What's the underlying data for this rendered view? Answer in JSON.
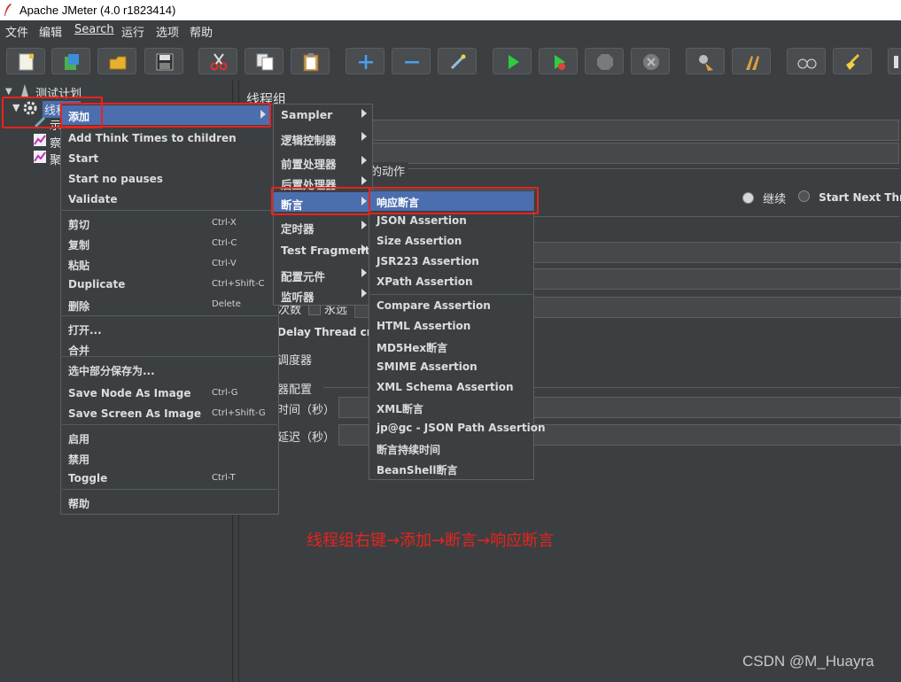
{
  "window": {
    "title": "Apache JMeter (4.0 r1823414)"
  },
  "menubar": {
    "items": [
      "文件",
      "编辑",
      "Search",
      "运行",
      "选项",
      "帮助"
    ]
  },
  "toolbar": {
    "icons": [
      "new-icon",
      "templates-icon",
      "open-icon",
      "save-icon",
      "cut-icon",
      "copy-icon",
      "paste-icon",
      "expand-icon",
      "collapse-icon",
      "toggle-icon",
      "start-icon",
      "start-no-pauses-icon",
      "stop-icon",
      "shutdown-icon",
      "clear-icon",
      "clear-all-icon",
      "search-icon",
      "reset-search-icon",
      "more-icon"
    ]
  },
  "tree": {
    "root_label": "测试计划",
    "thread_group_label": "线程组",
    "child1_label": "示",
    "child2_label": "察",
    "child3_label": "聚"
  },
  "right_panel": {
    "title": "线程组",
    "error_action_label": "的动作",
    "radio_continue": "继续",
    "radio_start_next": "Start Next Threa",
    "loop_label": "次数",
    "forever_label": "永远",
    "delay_label": "Delay Thread creat",
    "scheduler_label": "调度器",
    "scheduler_config_label": "器配置",
    "duration_label": "时间（秒）",
    "startup_delay_label": "延迟（秒）"
  },
  "context_menu": {
    "items": [
      {
        "label": "添加",
        "submenu": true,
        "selected": true
      },
      {
        "label": "Add Think Times to children"
      },
      {
        "label": "Start"
      },
      {
        "label": "Start no pauses"
      },
      {
        "label": "Validate"
      },
      {
        "label": "剪切",
        "accel": "Ctrl-X"
      },
      {
        "label": "复制",
        "accel": "Ctrl-C"
      },
      {
        "label": "粘贴",
        "accel": "Ctrl-V"
      },
      {
        "label": "Duplicate",
        "accel": "Ctrl+Shift-C"
      },
      {
        "label": "删除",
        "accel": "Delete"
      },
      {
        "label": "打开..."
      },
      {
        "label": "合并"
      },
      {
        "label": "选中部分保存为..."
      },
      {
        "label": "Save Node As Image",
        "accel": "Ctrl-G"
      },
      {
        "label": "Save Screen As Image",
        "accel": "Ctrl+Shift-G"
      },
      {
        "label": "启用"
      },
      {
        "label": "禁用"
      },
      {
        "label": "Toggle",
        "accel": "Ctrl-T"
      },
      {
        "label": "帮助"
      }
    ]
  },
  "add_submenu": {
    "items": [
      {
        "label": "Sampler"
      },
      {
        "label": "逻辑控制器"
      },
      {
        "label": "前置处理器"
      },
      {
        "label": "后置处理器"
      },
      {
        "label": "断言",
        "selected": true
      },
      {
        "label": "定时器"
      },
      {
        "label": "Test Fragment"
      },
      {
        "label": "配置元件"
      },
      {
        "label": "监听器"
      }
    ]
  },
  "assertion_submenu": {
    "items": [
      {
        "label": "响应断言",
        "selected": true
      },
      {
        "label": "JSON Assertion"
      },
      {
        "label": "Size Assertion"
      },
      {
        "label": "JSR223 Assertion"
      },
      {
        "label": "XPath Assertion"
      },
      {
        "label": "Compare Assertion"
      },
      {
        "label": "HTML Assertion"
      },
      {
        "label": "MD5Hex断言"
      },
      {
        "label": "SMIME Assertion"
      },
      {
        "label": "XML Schema Assertion"
      },
      {
        "label": "XML断言"
      },
      {
        "label": "jp@gc - JSON Path Assertion"
      },
      {
        "label": "断言持续时间"
      },
      {
        "label": "BeanShell断言"
      }
    ]
  },
  "annotation": "线程组右键→添加→断言→响应断言",
  "watermark": "CSDN @M_Huayra",
  "colors": {
    "background": "#3c3f41",
    "selection": "#4b6eaf",
    "highlight_box": "#e8231e"
  }
}
